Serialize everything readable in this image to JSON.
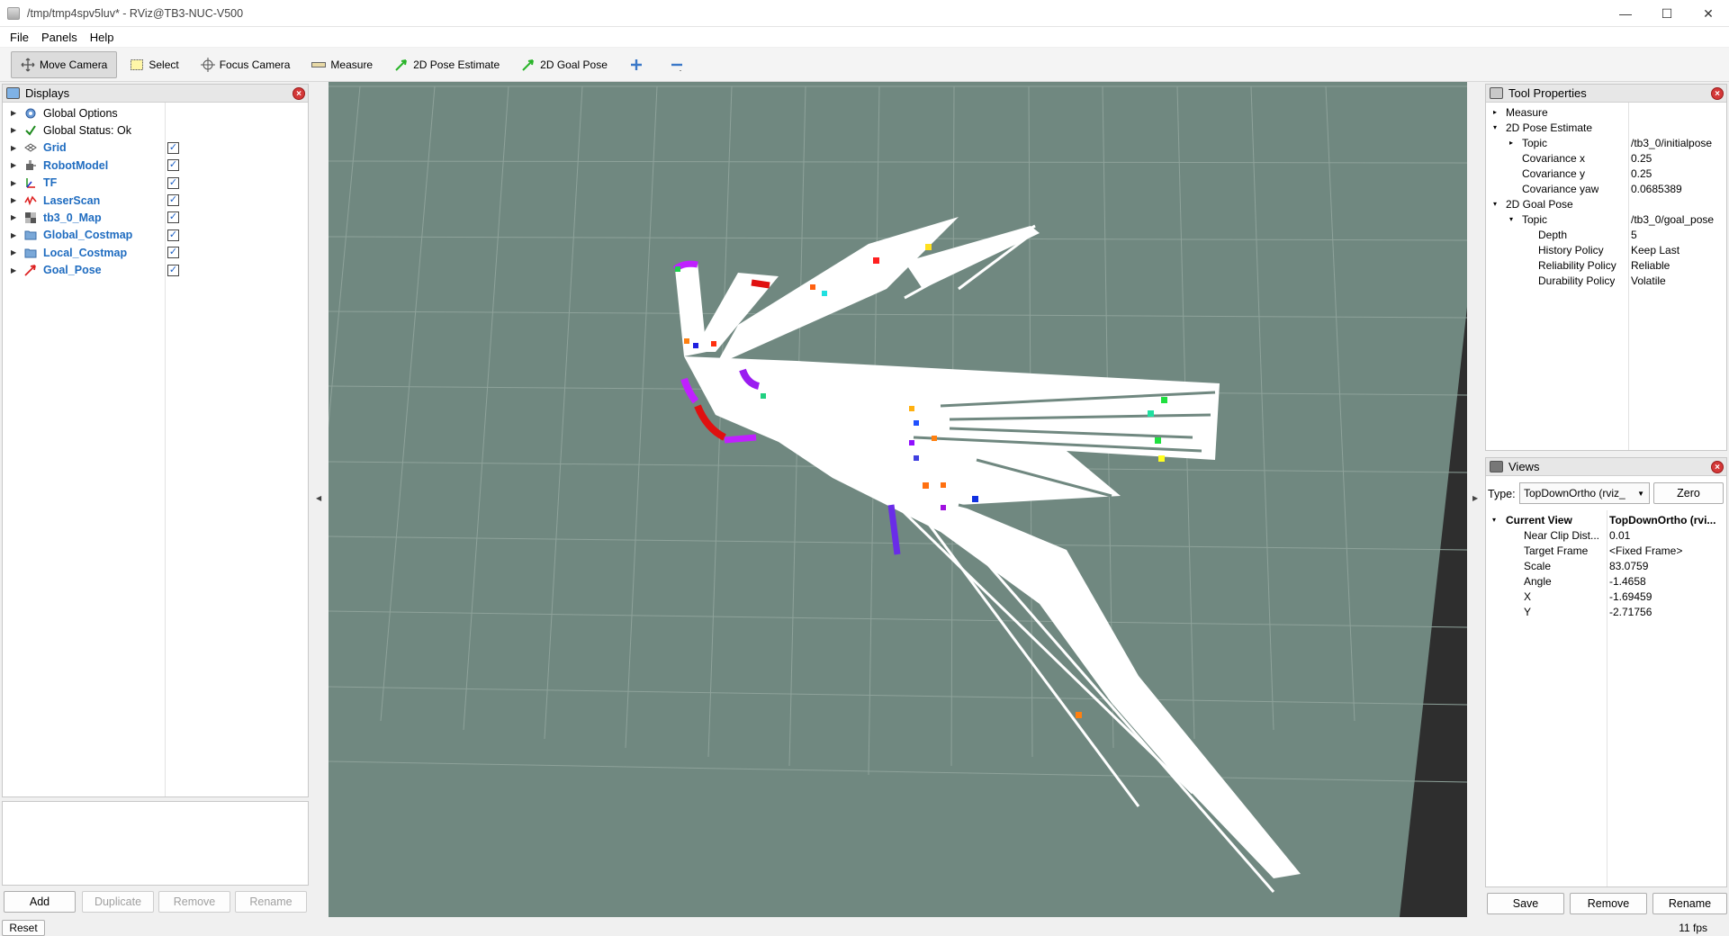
{
  "window": {
    "title": "/tmp/tmp4spv5luv* - RViz@TB3-NUC-V500",
    "min": "—",
    "max": "☐",
    "close": "✕"
  },
  "menu": {
    "file": "File",
    "panels": "Panels",
    "help": "Help"
  },
  "toolbar": {
    "move_camera": "Move Camera",
    "select": "Select",
    "focus_camera": "Focus Camera",
    "measure": "Measure",
    "pose_estimate": "2D Pose Estimate",
    "goal_pose": "2D Goal Pose"
  },
  "displays": {
    "title": "Displays",
    "items": [
      {
        "label": "Global Options",
        "icon": "gear-icon",
        "checkbox": false,
        "blue": false
      },
      {
        "label": "Global Status: Ok",
        "icon": "checkmark-icon",
        "checkbox": false,
        "blue": false
      },
      {
        "label": "Grid",
        "icon": "grid-icon",
        "checkbox": true,
        "blue": true
      },
      {
        "label": "RobotModel",
        "icon": "robot-icon",
        "checkbox": true,
        "blue": true
      },
      {
        "label": "TF",
        "icon": "axes-icon",
        "checkbox": true,
        "blue": true
      },
      {
        "label": "LaserScan",
        "icon": "laser-icon",
        "checkbox": true,
        "blue": true
      },
      {
        "label": "tb3_0_Map",
        "icon": "map-icon",
        "checkbox": true,
        "blue": true
      },
      {
        "label": "Global_Costmap",
        "icon": "folder-icon",
        "checkbox": true,
        "blue": true
      },
      {
        "label": "Local_Costmap",
        "icon": "folder-icon",
        "checkbox": true,
        "blue": true
      },
      {
        "label": "Goal_Pose",
        "icon": "arrow-icon",
        "checkbox": true,
        "blue": true
      }
    ],
    "buttons": {
      "add": "Add",
      "duplicate": "Duplicate",
      "remove": "Remove",
      "rename": "Rename"
    },
    "reset": "Reset"
  },
  "tool_properties": {
    "title": "Tool Properties",
    "rows": [
      {
        "indent": 0,
        "arrow": "▸",
        "name": "Measure",
        "value": ""
      },
      {
        "indent": 0,
        "arrow": "▾",
        "name": "2D Pose Estimate",
        "value": ""
      },
      {
        "indent": 1,
        "arrow": "▸",
        "name": "Topic",
        "value": "/tb3_0/initialpose"
      },
      {
        "indent": 1,
        "arrow": "",
        "name": "Covariance x",
        "value": "0.25"
      },
      {
        "indent": 1,
        "arrow": "",
        "name": "Covariance y",
        "value": "0.25"
      },
      {
        "indent": 1,
        "arrow": "",
        "name": "Covariance yaw",
        "value": "0.0685389"
      },
      {
        "indent": 0,
        "arrow": "▾",
        "name": "2D Goal Pose",
        "value": ""
      },
      {
        "indent": 1,
        "arrow": "▾",
        "name": "Topic",
        "value": "/tb3_0/goal_pose"
      },
      {
        "indent": 2,
        "arrow": "",
        "name": "Depth",
        "value": "5"
      },
      {
        "indent": 2,
        "arrow": "",
        "name": "History Policy",
        "value": "Keep Last"
      },
      {
        "indent": 2,
        "arrow": "",
        "name": "Reliability Policy",
        "value": "Reliable"
      },
      {
        "indent": 2,
        "arrow": "",
        "name": "Durability Policy",
        "value": "Volatile"
      }
    ]
  },
  "views": {
    "title": "Views",
    "type_label": "Type:",
    "type_value": "TopDownOrtho (rviz_",
    "zero": "Zero",
    "current_view": "Current View",
    "current_view_value": "TopDownOrtho (rvi...",
    "rows": [
      {
        "name": "Near Clip Dist...",
        "value": "0.01"
      },
      {
        "name": "Target Frame",
        "value": "<Fixed Frame>"
      },
      {
        "name": "Scale",
        "value": "83.0759"
      },
      {
        "name": "Angle",
        "value": "-1.4658"
      },
      {
        "name": "X",
        "value": "-1.69459"
      },
      {
        "name": "Y",
        "value": "-2.71756"
      }
    ],
    "buttons": {
      "save": "Save",
      "remove": "Remove",
      "rename": "Rename"
    }
  },
  "status": {
    "fps": "11 fps"
  },
  "colors": {
    "viewport_bg": "#708880",
    "free_space": "#ffffff",
    "accent_blue": "#1f6cc0"
  }
}
